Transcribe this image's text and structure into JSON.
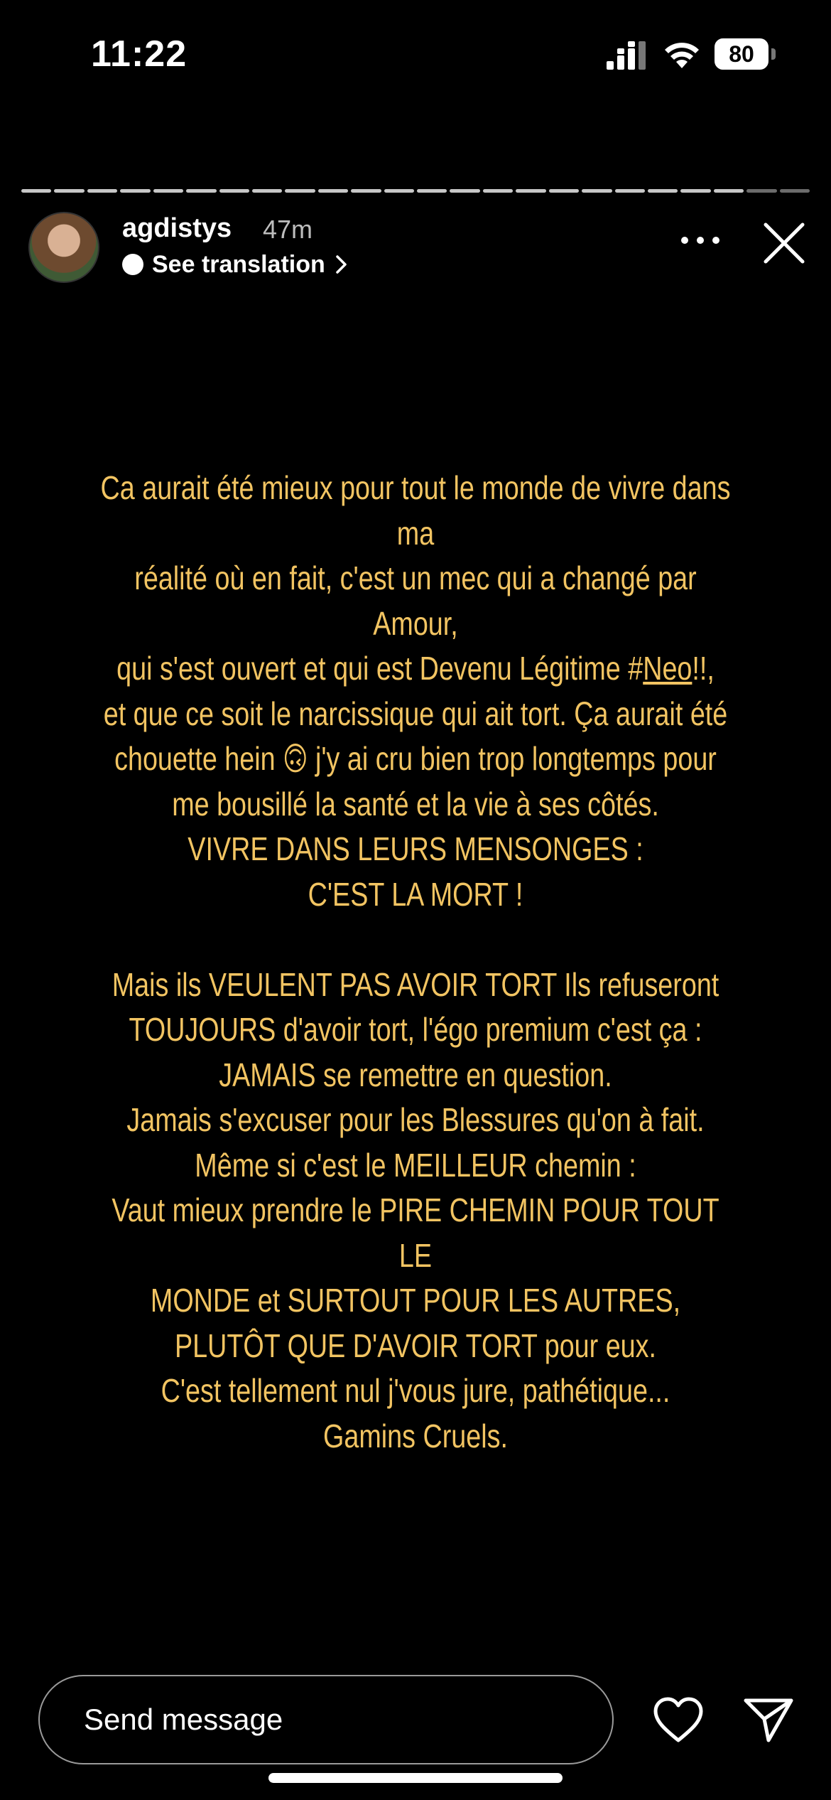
{
  "status_bar": {
    "time": "11:22",
    "battery": "80"
  },
  "story": {
    "segments_total": 24,
    "segments_viewed": 22,
    "progress_color": "#c7c7c7"
  },
  "header": {
    "username": "agdistys",
    "posted": "47m",
    "translation_label": "See translation"
  },
  "body": {
    "text_color": "#f2c462",
    "lines": [
      "Ca aurait été mieux pour tout le monde de vivre dans ma",
      "réalité où en fait, c'est un mec qui a changé par Amour,",
      "qui s'est ouvert et qui est Devenu Légitime #Neo!!,",
      "et que ce soit le narcissique qui ait tort. Ça aurait été",
      "chouette hein 🙃 j'y ai cru bien trop longtemps pour",
      "me bousillé la santé et la vie à ses côtés.",
      "VIVRE DANS LEURS MENSONGES :",
      "C'EST LA MORT !",
      "",
      "Mais ils VEULENT PAS AVOIR TORT Ils refuseront",
      "TOUJOURS d'avoir tort, l'égo premium c'est ça :",
      "JAMAIS se remettre en question.",
      "Jamais s'excuser pour les Blessures qu'on à fait.",
      "Même si c'est le MEILLEUR chemin :",
      "Vaut mieux prendre le PIRE CHEMIN POUR TOUT LE",
      "MONDE et SURTOUT POUR LES AUTRES,",
      "PLUTÔT QUE D'AVOIR TORT pour eux.",
      "C'est tellement nul j'vous jure, pathétique...",
      "Gamins Cruels."
    ]
  },
  "footer": {
    "message_placeholder": "Send message"
  }
}
